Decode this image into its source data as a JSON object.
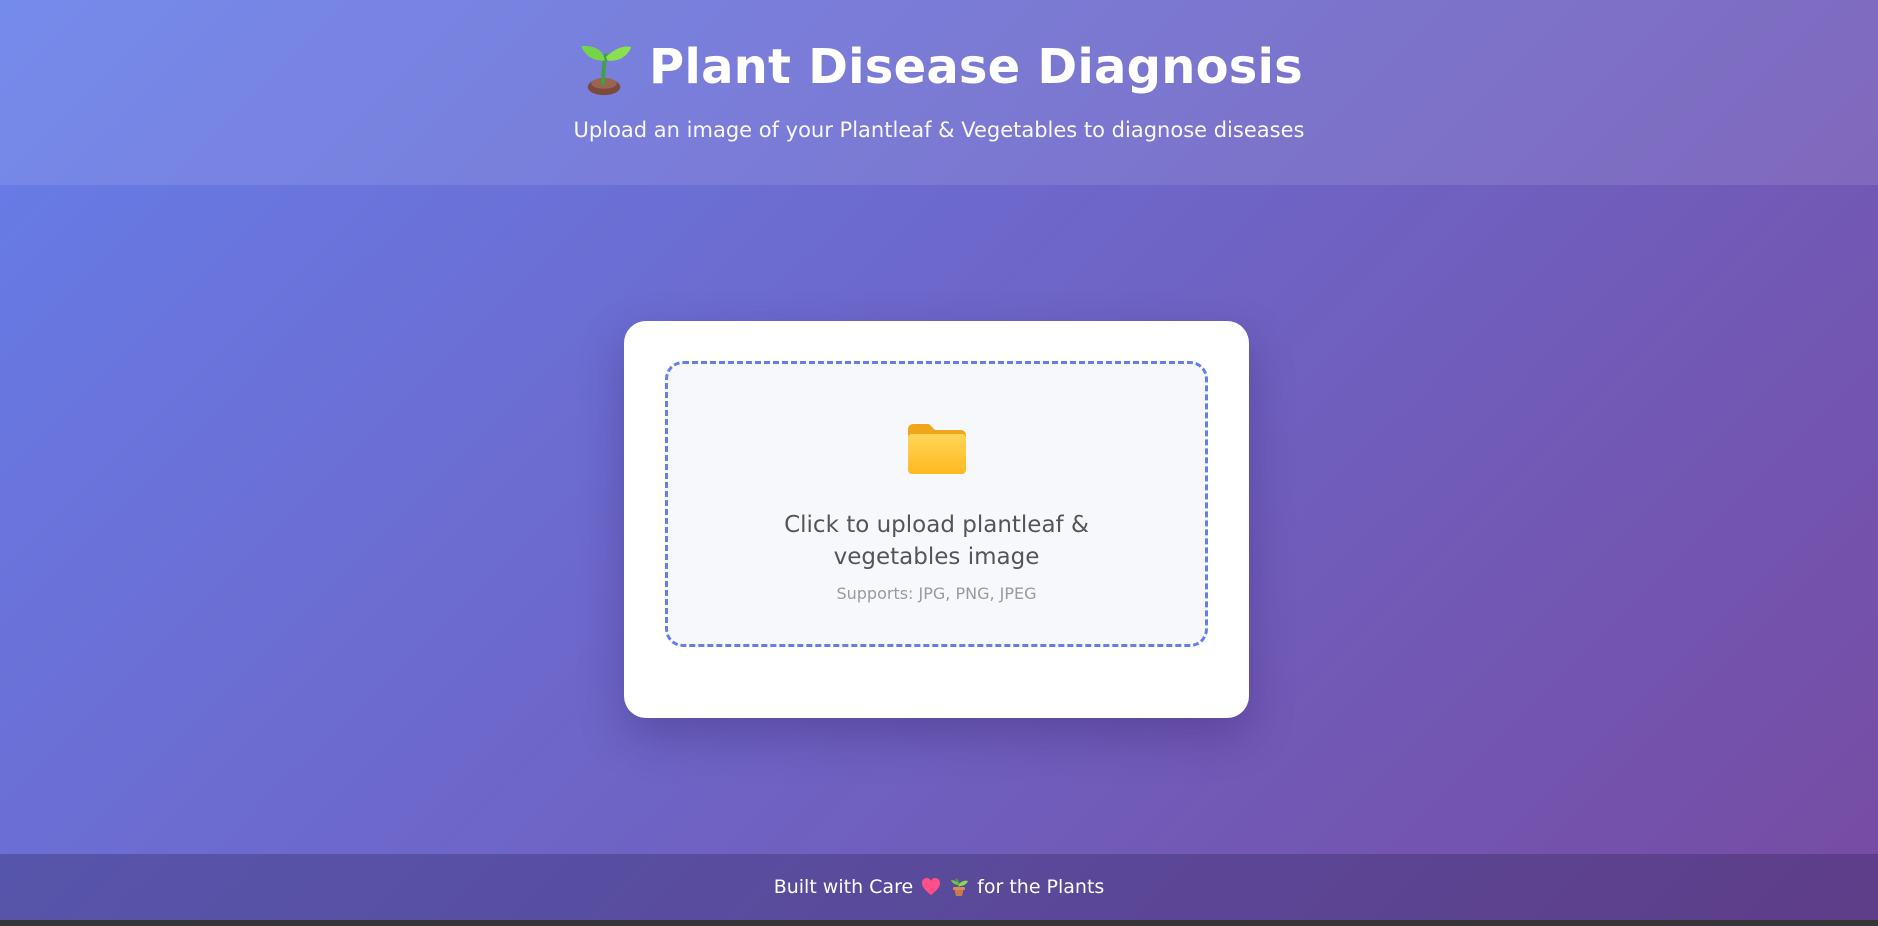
{
  "header": {
    "title": "Plant Disease Diagnosis",
    "subtitle": "Upload an image of your Plantleaf & Vegetables to diagnose diseases",
    "title_icon": "sprout-icon"
  },
  "uploader": {
    "icon": "folder-icon",
    "prompt": "Click to upload plantleaf & vegetables image",
    "supports": "Supports: JPG, PNG, JPEG"
  },
  "footer": {
    "text_start": "Built with Care",
    "heart_icon": "heart-icon",
    "plant_icon": "potted-plant-icon",
    "text_end": "for the Plants"
  },
  "colors": {
    "gradient_start": "#667eea",
    "gradient_end": "#764ba2",
    "accent": "#667eea"
  }
}
